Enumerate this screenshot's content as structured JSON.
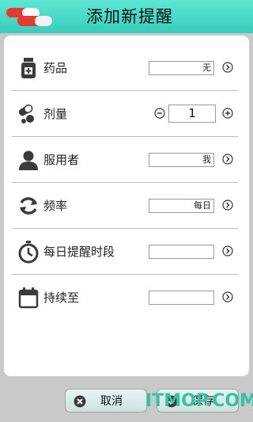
{
  "header": {
    "title": "添加新提醒",
    "logo_icon": "pill-capsule-icon",
    "color": "#45d6c3"
  },
  "rows": [
    {
      "label": "药品",
      "icon": "medicine-bottle-icon",
      "value": "无",
      "action_icon": "chevron-right-circle-icon"
    },
    {
      "label": "剂量",
      "icon": "pills-icon",
      "value": "1",
      "minus_icon": "minus-circle-icon",
      "plus_icon": "plus-circle-icon"
    },
    {
      "label": "服用者",
      "icon": "person-icon",
      "value": "我",
      "action_icon": "chevron-right-circle-icon"
    },
    {
      "label": "频率",
      "icon": "refresh-icon",
      "value": "每日",
      "action_icon": "chevron-right-circle-icon"
    },
    {
      "label": "每日提醒时段",
      "icon": "stopwatch-icon",
      "value": "",
      "action_icon": "chevron-right-circle-icon"
    },
    {
      "label": "持续至",
      "icon": "calendar-icon",
      "value": "",
      "action_icon": "chevron-right-circle-icon"
    }
  ],
  "buttons": {
    "cancel": {
      "label": "取消",
      "icon": "close-circle-icon"
    },
    "save": {
      "label": "保存",
      "icon": "check-circle-icon"
    }
  },
  "watermark": "ITMOP.COM"
}
